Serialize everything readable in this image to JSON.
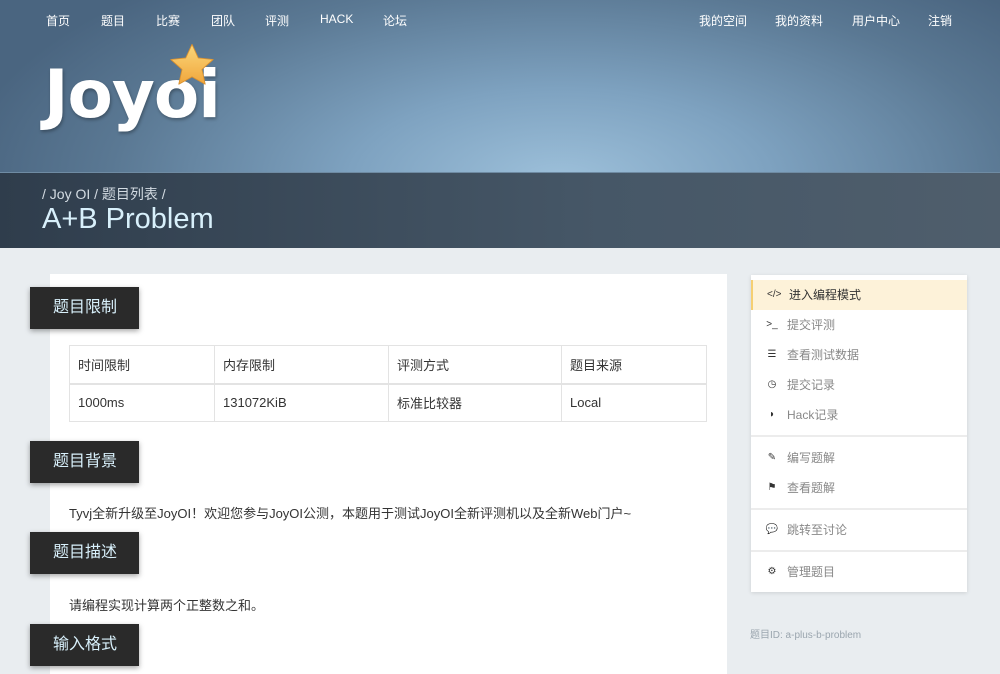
{
  "nav_left": [
    "首页",
    "题目",
    "比赛",
    "团队",
    "评测",
    "HACK",
    "论坛"
  ],
  "nav_right": [
    "我的空间",
    "我的资料",
    "用户中心",
    "注销"
  ],
  "logo": "Joyoi",
  "breadcrumb": "/ Joy OI / 题目列表 /",
  "title": "A+B Problem",
  "sections": {
    "limits": "题目限制",
    "background": "题目背景",
    "description": "题目描述",
    "input": "输入格式"
  },
  "table": {
    "headers": [
      "时间限制",
      "内存限制",
      "评测方式",
      "题目来源"
    ],
    "row": [
      "1000ms",
      "131072KiB",
      "标准比较器",
      "Local"
    ]
  },
  "background_text": "Tyvj全新升级至JoyOI！欢迎您参与JoyOI公测，本题用于测试JoyOI全新评测机以及全新Web门户~",
  "description_text": "请编程实现计算两个正整数之和。",
  "sidebar": [
    {
      "icon": "code-icon",
      "glyph": "</>",
      "label": "进入编程模式"
    },
    {
      "icon": "terminal-icon",
      "glyph": ">_",
      "label": "提交评测"
    },
    {
      "icon": "database-icon",
      "glyph": "☰",
      "label": "查看测试数据"
    },
    {
      "icon": "clock-icon",
      "glyph": "◷",
      "label": "提交记录"
    },
    {
      "icon": "shield-icon",
      "glyph": "◗",
      "label": "Hack记录"
    },
    {
      "icon": "edit-icon",
      "glyph": "✎",
      "label": "编写题解"
    },
    {
      "icon": "flag-icon",
      "glyph": "⚑",
      "label": "查看题解"
    },
    {
      "icon": "comment-icon",
      "glyph": "💬",
      "label": "跳转至讨论"
    },
    {
      "icon": "gear-icon",
      "glyph": "⚙",
      "label": "管理题目"
    }
  ],
  "problem_id": "题目ID: a-plus-b-problem"
}
